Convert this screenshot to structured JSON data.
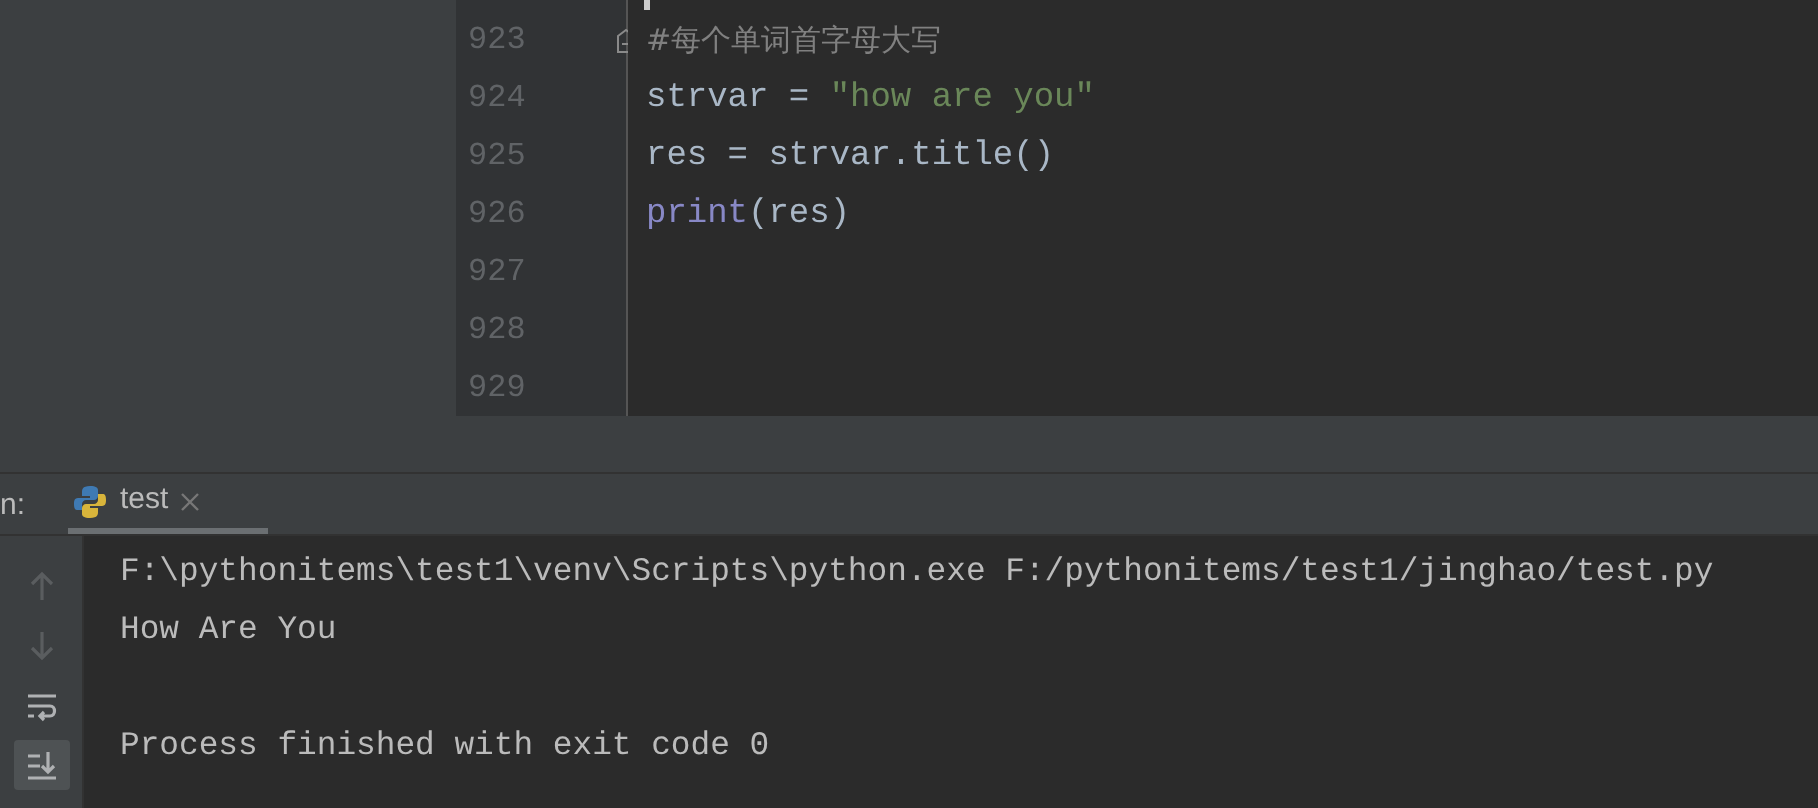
{
  "editor": {
    "lines": [
      {
        "number": "923",
        "tokens": [
          {
            "kind": "comment",
            "text": "#每个单词首字母大写"
          }
        ],
        "fold": true
      },
      {
        "number": "924",
        "tokens": [
          {
            "kind": "plain",
            "text": "strvar = "
          },
          {
            "kind": "string",
            "text": "\"how are you\""
          }
        ],
        "fold": false
      },
      {
        "number": "925",
        "tokens": [
          {
            "kind": "plain",
            "text": "res = strvar.title()"
          }
        ],
        "fold": false
      },
      {
        "number": "926",
        "tokens": [
          {
            "kind": "builtin",
            "text": "print"
          },
          {
            "kind": "plain",
            "text": "(res)"
          }
        ],
        "fold": false
      },
      {
        "number": "927",
        "fold": false
      },
      {
        "number": "928",
        "fold": false
      },
      {
        "number": "929",
        "fold": false
      }
    ]
  },
  "run_panel": {
    "label": "n:",
    "tabs": [
      {
        "label": "test",
        "selected": true
      }
    ],
    "tools": [
      {
        "kind": "up",
        "selected": false,
        "disabled": true
      },
      {
        "kind": "down",
        "selected": false,
        "disabled": true
      },
      {
        "kind": "wrap",
        "selected": false,
        "disabled": false
      },
      {
        "kind": "scroll-end",
        "selected": true,
        "disabled": false
      }
    ],
    "output": [
      {
        "kind": "text",
        "text": "F:\\pythonitems\\test1\\venv\\Scripts\\python.exe F:/pythonitems/test1/jinghao/test.py"
      },
      {
        "kind": "text",
        "text": "How Are You"
      },
      {
        "kind": "blank"
      },
      {
        "kind": "text",
        "text": "Process finished with exit code 0"
      }
    ]
  }
}
